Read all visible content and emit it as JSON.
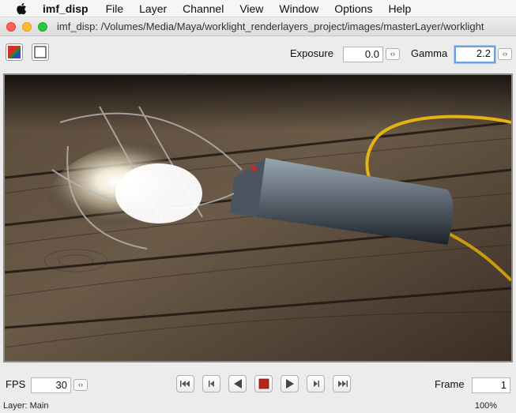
{
  "menubar": {
    "apple_icon": "apple-icon",
    "app_name": "imf_disp",
    "items": [
      "File",
      "Layer",
      "Channel",
      "View",
      "Window",
      "Options",
      "Help"
    ]
  },
  "window": {
    "title": "imf_disp: /Volumes/Media/Maya/worklight_renderlayers_project/images/masterLayer/worklight"
  },
  "toolbar": {
    "color_mode_icon": "rgb-channels-icon",
    "frame_toggle_icon": "white-square-icon",
    "exposure_label": "Exposure",
    "exposure_value": "0.0",
    "gamma_label": "Gamma",
    "gamma_value": "2.2",
    "stepper_glyph": "‹›"
  },
  "viewport": {
    "description_icon": "rendered-image"
  },
  "playback": {
    "fps_label": "FPS",
    "fps_value": "30",
    "frame_label": "Frame",
    "frame_value": "1",
    "buttons": [
      "first-frame",
      "previous-frame",
      "play-backward",
      "stop",
      "play-forward",
      "next-frame",
      "last-frame"
    ]
  },
  "status": {
    "layer": "Layer: Main",
    "zoom": "100%"
  },
  "colors": {
    "stop_red": "#b8231c",
    "focus_blue": "#6aa0e8",
    "cord_yellow": "#e2b312"
  }
}
